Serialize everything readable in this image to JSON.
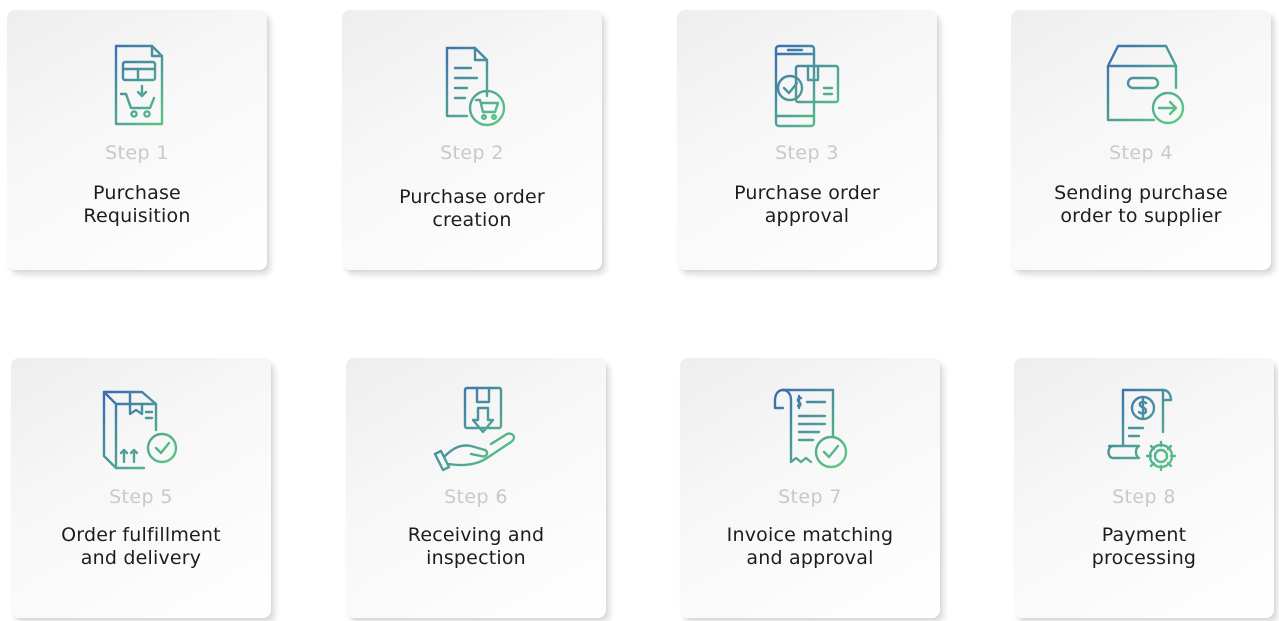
{
  "colors": {
    "gradient_start": "#3d6db0",
    "gradient_end": "#5fd07e",
    "step_text": "#c9c9c9",
    "title_text": "#1d1d1f"
  },
  "steps": [
    {
      "step": "Step 1",
      "title_line1": "Purchase",
      "title_line2": "Requisition",
      "icon": "requisition-cart-document-icon"
    },
    {
      "step": "Step 2",
      "title_line1": "Purchase order",
      "title_line2": "creation",
      "icon": "document-cart-icon"
    },
    {
      "step": "Step 3",
      "title_line1": "Purchase order",
      "title_line2": "approval",
      "icon": "phone-approval-package-icon"
    },
    {
      "step": "Step 4",
      "title_line1": "Sending purchase",
      "title_line2": "order to supplier",
      "icon": "box-send-arrow-icon"
    },
    {
      "step": "Step 5",
      "title_line1": "Order fulfillment",
      "title_line2": "and delivery",
      "icon": "package-delivered-check-icon"
    },
    {
      "step": "Step 6",
      "title_line1": "Receiving and",
      "title_line2": "inspection",
      "icon": "hand-receive-package-icon"
    },
    {
      "step": "Step 7",
      "title_line1": "Invoice matching",
      "title_line2": "and approval",
      "icon": "invoice-check-icon"
    },
    {
      "step": "Step 8",
      "title_line1": "Payment",
      "title_line2": "processing",
      "icon": "payment-scroll-gear-icon"
    }
  ]
}
